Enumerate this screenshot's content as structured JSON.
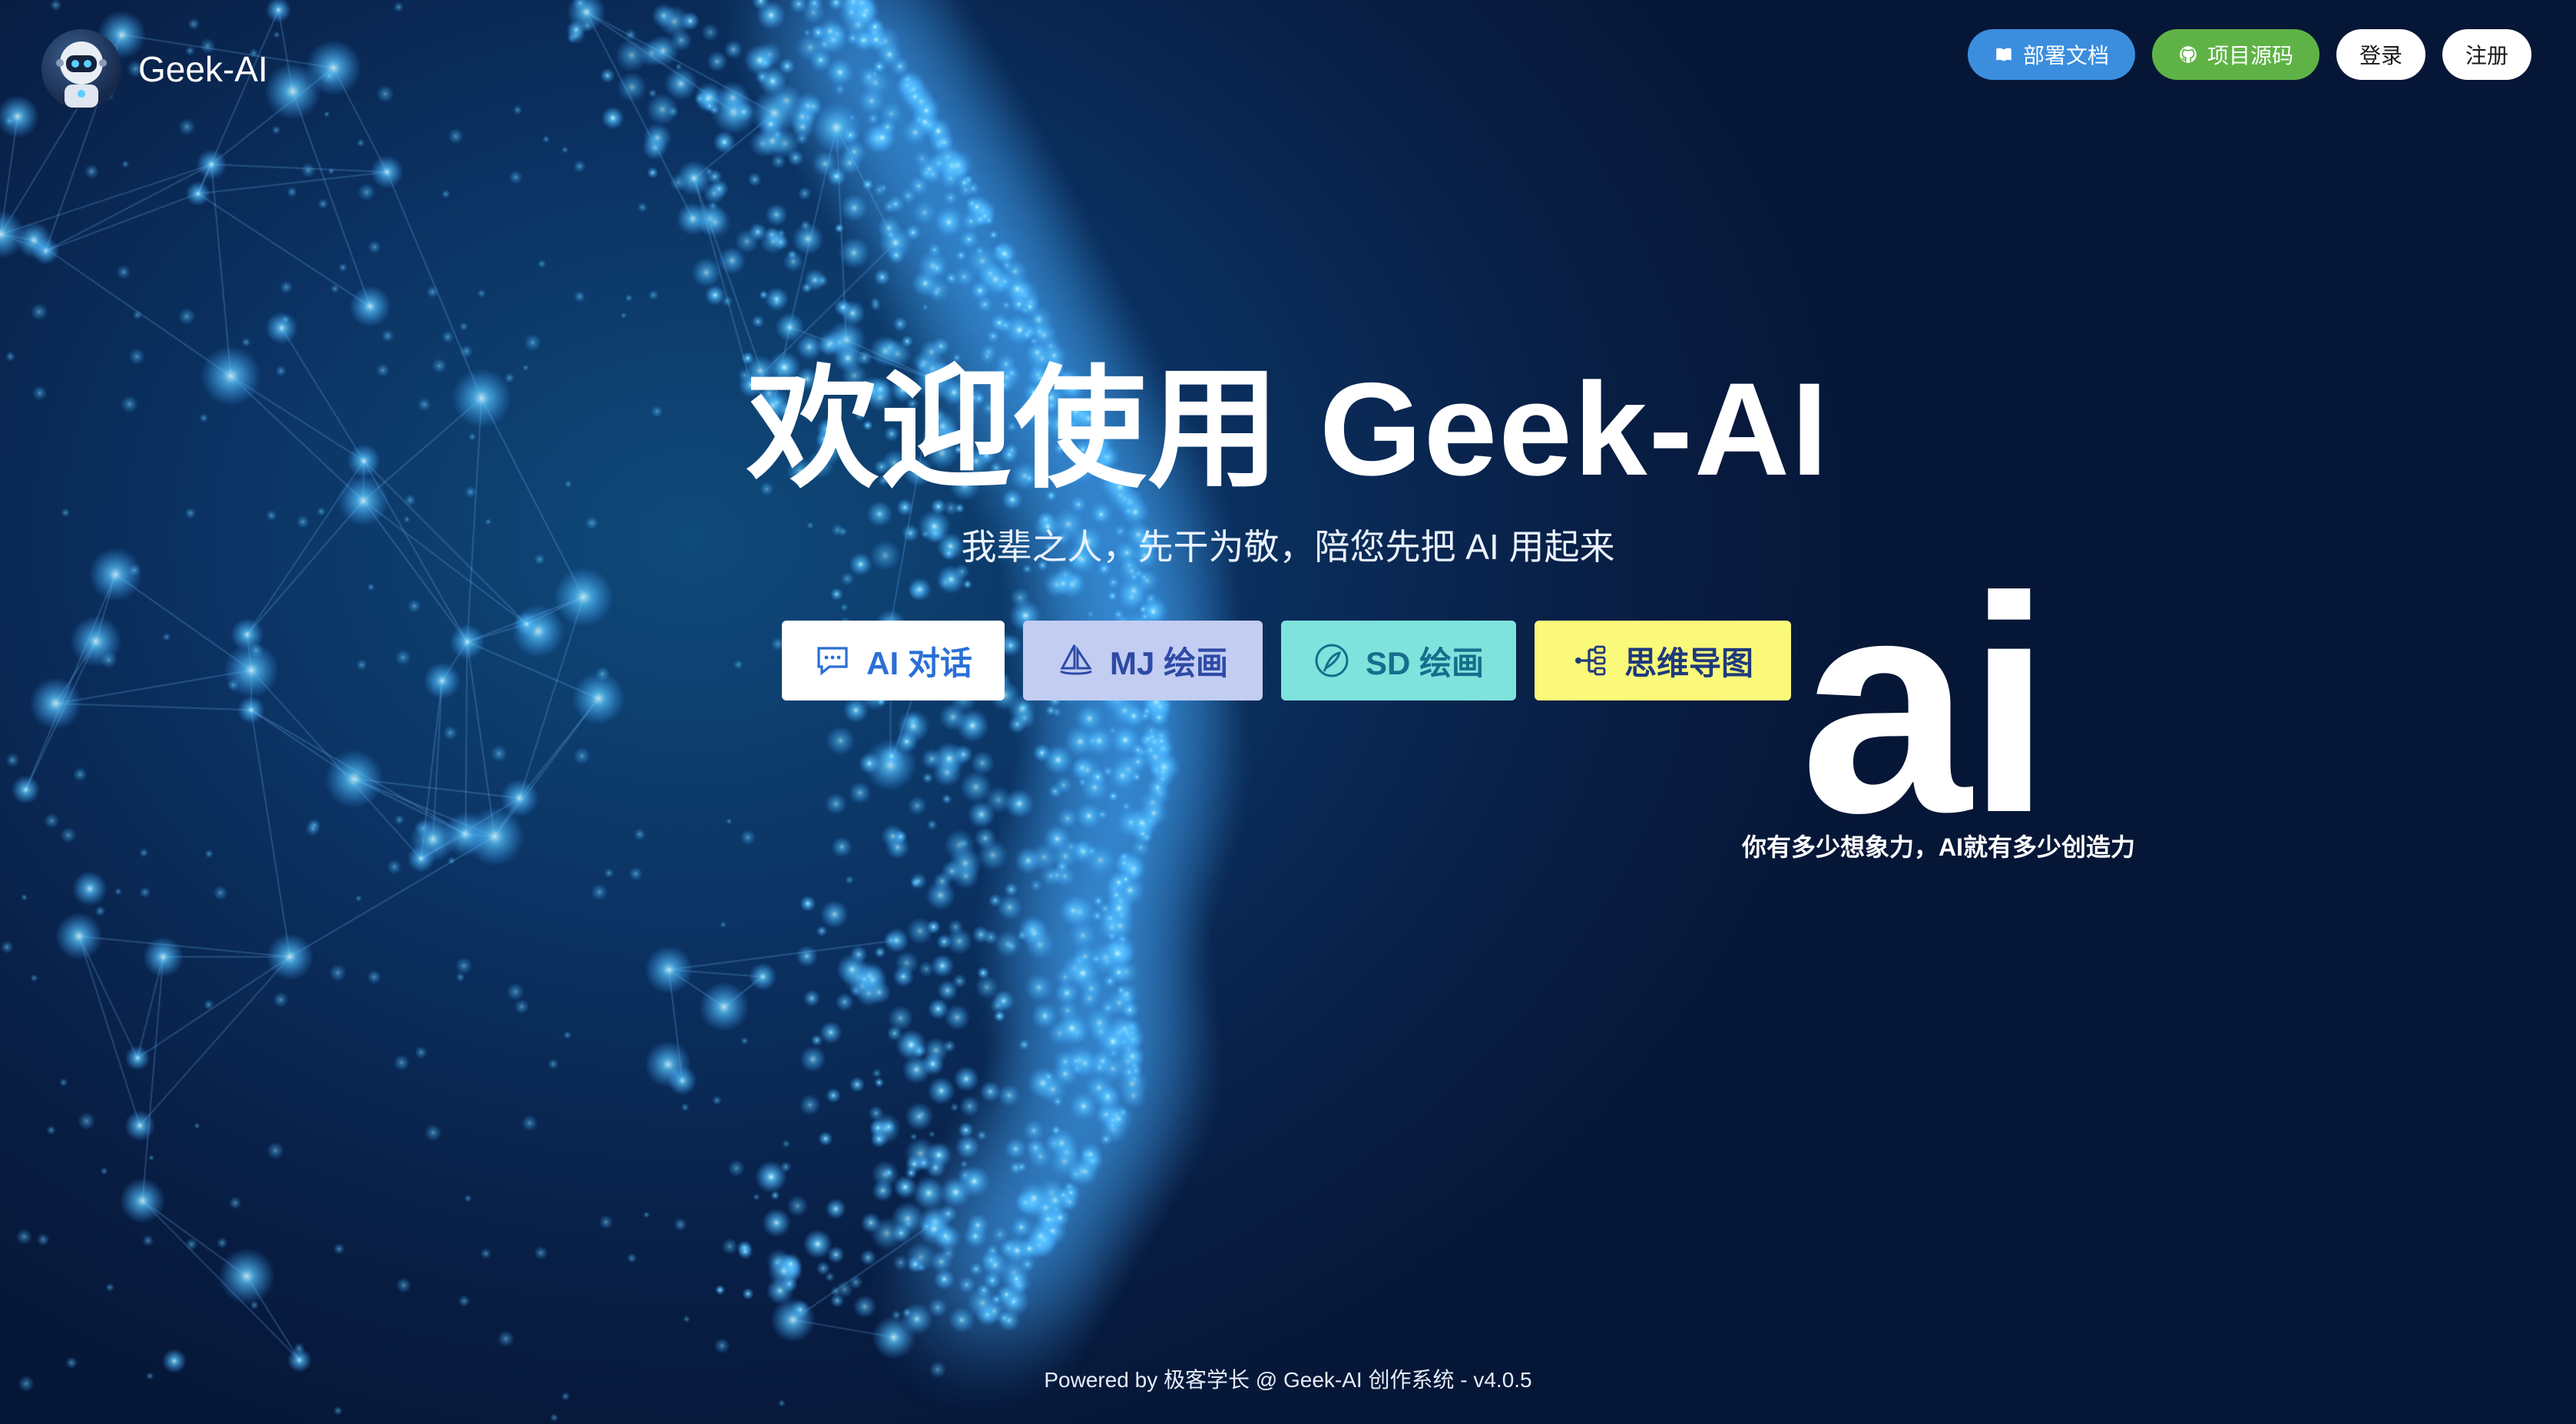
{
  "brand": {
    "name": "Geek-AI",
    "logo_icon": "robot-avatar-icon"
  },
  "topnav": {
    "docs": {
      "label": "部署文档",
      "icon": "book-icon",
      "color": "#3b8ede"
    },
    "source": {
      "label": "项目源码",
      "icon": "github-icon",
      "color": "#5fb346"
    },
    "login": {
      "label": "登录"
    },
    "register": {
      "label": "注册"
    }
  },
  "hero": {
    "title": "欢迎使用 Geek-AI",
    "subtitle": "我辈之人，先干为敬，陪您先把 AI 用起来"
  },
  "actions": [
    {
      "label": "AI 对话",
      "icon": "chat-bubble-icon",
      "color": "#ffffff"
    },
    {
      "label": "MJ 绘画",
      "icon": "sailboat-icon",
      "color": "#c3cdf2"
    },
    {
      "label": "SD 绘画",
      "icon": "quill-icon",
      "color": "#7ee3dc"
    },
    {
      "label": "思维导图",
      "icon": "mind-map-icon",
      "color": "#fbf97a"
    }
  ],
  "ai_logo": {
    "text": "ai",
    "caption": "你有多少想象力，AI就有多少创造力"
  },
  "footer": {
    "text": "Powered by 极客学长 @ Geek-AI 创作系统 - v4.0.5"
  },
  "colors": {
    "background": "#0b3262",
    "glow": "#4fc3ff"
  }
}
